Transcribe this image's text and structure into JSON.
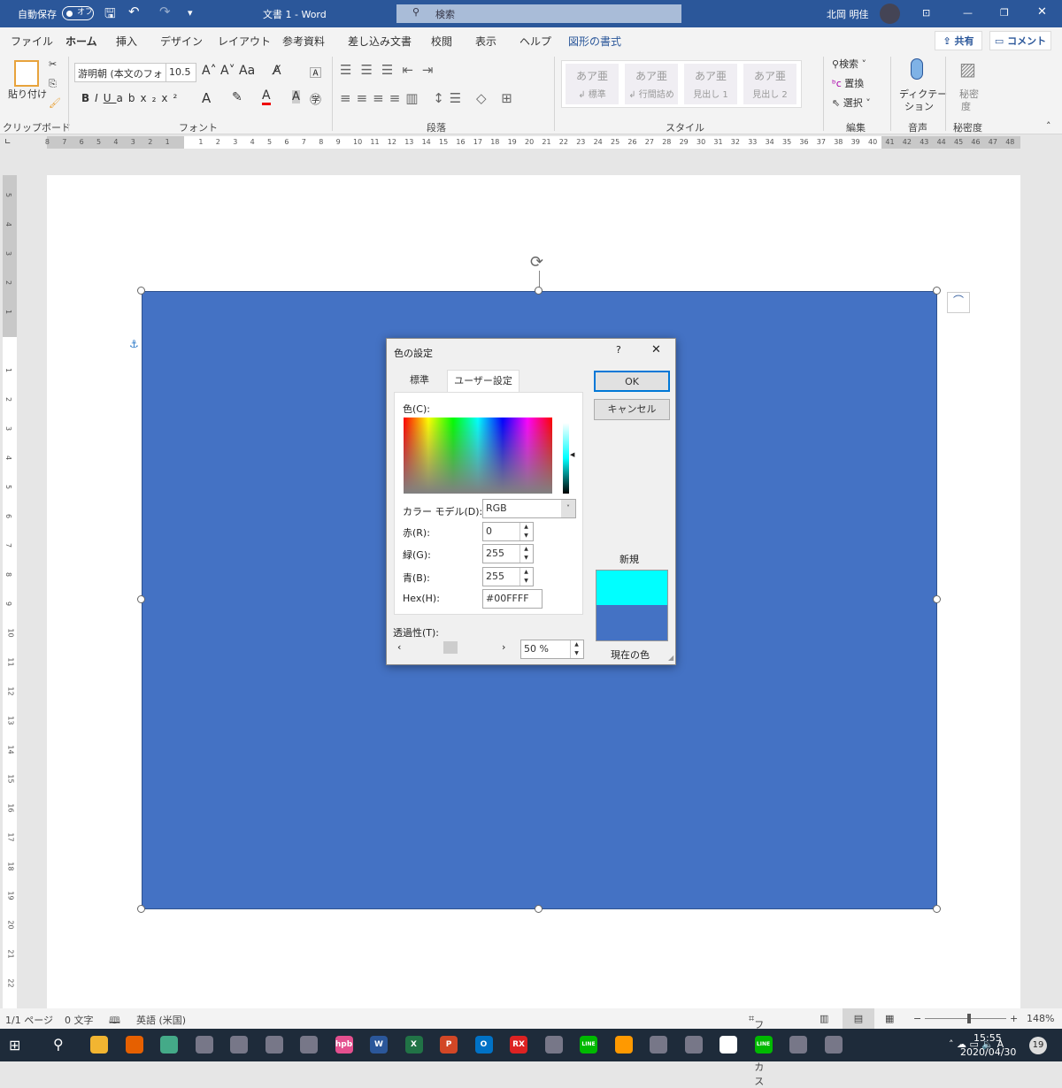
{
  "titlebar": {
    "autosave_label": "自動保存",
    "autosave_state": "オフ",
    "doc_title": "文書 1  -  Word",
    "search_placeholder": "検索",
    "user_name": "北岡 明佳"
  },
  "ribbon_tabs": [
    "ファイル",
    "ホーム",
    "挿入",
    "デザイン",
    "レイアウト",
    "参考資料",
    "差し込み文書",
    "校閲",
    "表示",
    "ヘルプ",
    "図形の書式"
  ],
  "share_label": "共有",
  "comment_label": "コメント",
  "clipboard": {
    "paste_label": "貼り付け",
    "group": "クリップボード"
  },
  "font": {
    "name": "游明朝 (本文のフォ",
    "size": "10.5",
    "group": "フォント"
  },
  "paragraph": {
    "group": "段落"
  },
  "styles": {
    "group": "スタイル",
    "items": [
      {
        "sample": "あア亜",
        "name": "↲ 標準"
      },
      {
        "sample": "あア亜",
        "name": "↲ 行間詰め"
      },
      {
        "sample": "あア亜",
        "name": "見出し 1"
      },
      {
        "sample": "あア亜",
        "name": "見出し 2"
      }
    ]
  },
  "editing": {
    "find": "検索",
    "replace": "置換",
    "select": "選択",
    "group": "編集"
  },
  "voice": {
    "dictate_1": "ディクテー",
    "dictate_2": "ション",
    "group": "音声"
  },
  "sensitivity": {
    "label_1": "秘密",
    "label_2": "度",
    "group": "秘密度"
  },
  "ruler": {
    "left": [
      "8",
      "7",
      "6",
      "5",
      "4",
      "3",
      "2",
      "1"
    ],
    "right_max": 48,
    "vertical_max": 22
  },
  "dialog": {
    "title": "色の設定",
    "help": "?",
    "tabs": [
      "標準",
      "ユーザー設定"
    ],
    "active_tab": 1,
    "color_label": "色(C):",
    "model_label": "カラー モデル(D):",
    "model_value": "RGB",
    "red_label": "赤(R):",
    "red": "0",
    "green_label": "緑(G):",
    "green": "255",
    "blue_label": "青(B):",
    "blue": "255",
    "hex_label": "Hex(H):",
    "hex": "#00FFFF",
    "transparency_label": "透過性(T):",
    "transparency": "50",
    "transparency_unit": "%",
    "transparency_percent": 50,
    "ok": "OK",
    "cancel": "キャンセル",
    "new_label": "新規",
    "current_label": "現在の色",
    "new_color": "#00FFFF",
    "current_color": "#4472C4"
  },
  "shape_fill": "#4472C4",
  "status": {
    "page": "1/1 ページ",
    "words": "0 文字",
    "language": "英語 (米国)",
    "focus": "フォーカス",
    "zoom": "148%"
  },
  "taskbar": {
    "icons": [
      "explorer",
      "firefox",
      "chrome",
      "app",
      "camera",
      "app",
      "app",
      "hpb",
      "word",
      "excel",
      "powerpoint",
      "outlook",
      "rx",
      "app",
      "line",
      "search",
      "app",
      "app",
      "slack",
      "line",
      "app",
      "app"
    ],
    "time": "15:55",
    "date": "2020/04/30",
    "notifications": "19"
  }
}
